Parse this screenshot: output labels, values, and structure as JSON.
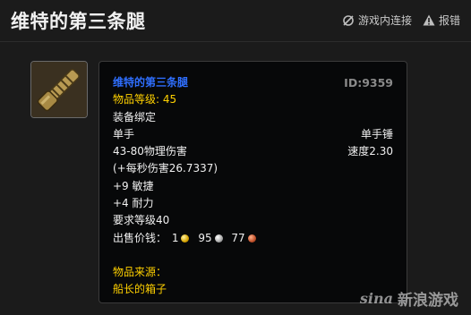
{
  "header": {
    "title": "维特的第三条腿",
    "link_label": "游戏内连接",
    "report_label": "报错"
  },
  "item": {
    "name": "维特的第三条腿",
    "id": "ID:9359",
    "item_level": "物品等级: 45",
    "bind": "装备绑定",
    "slot": "单手",
    "type": "单手锤",
    "damage": "43-80物理伤害",
    "speed": "速度2.30",
    "dps": "(+每秒伤害26.7337)",
    "stat1": "+9 敏捷",
    "stat2": "+4 耐力",
    "req_level": "要求等级40",
    "sell_label": "出售价钱：",
    "gold": "1",
    "silver": "95",
    "copper": "77",
    "source_label": "物品来源：",
    "source_value": "船长的箱子"
  },
  "watermark": {
    "logo": "sina",
    "text": "新浪游戏"
  },
  "colors": {
    "item_name": "#2f6fff",
    "gold_text": "#ffd100",
    "tooltip_bg": "#070809"
  }
}
